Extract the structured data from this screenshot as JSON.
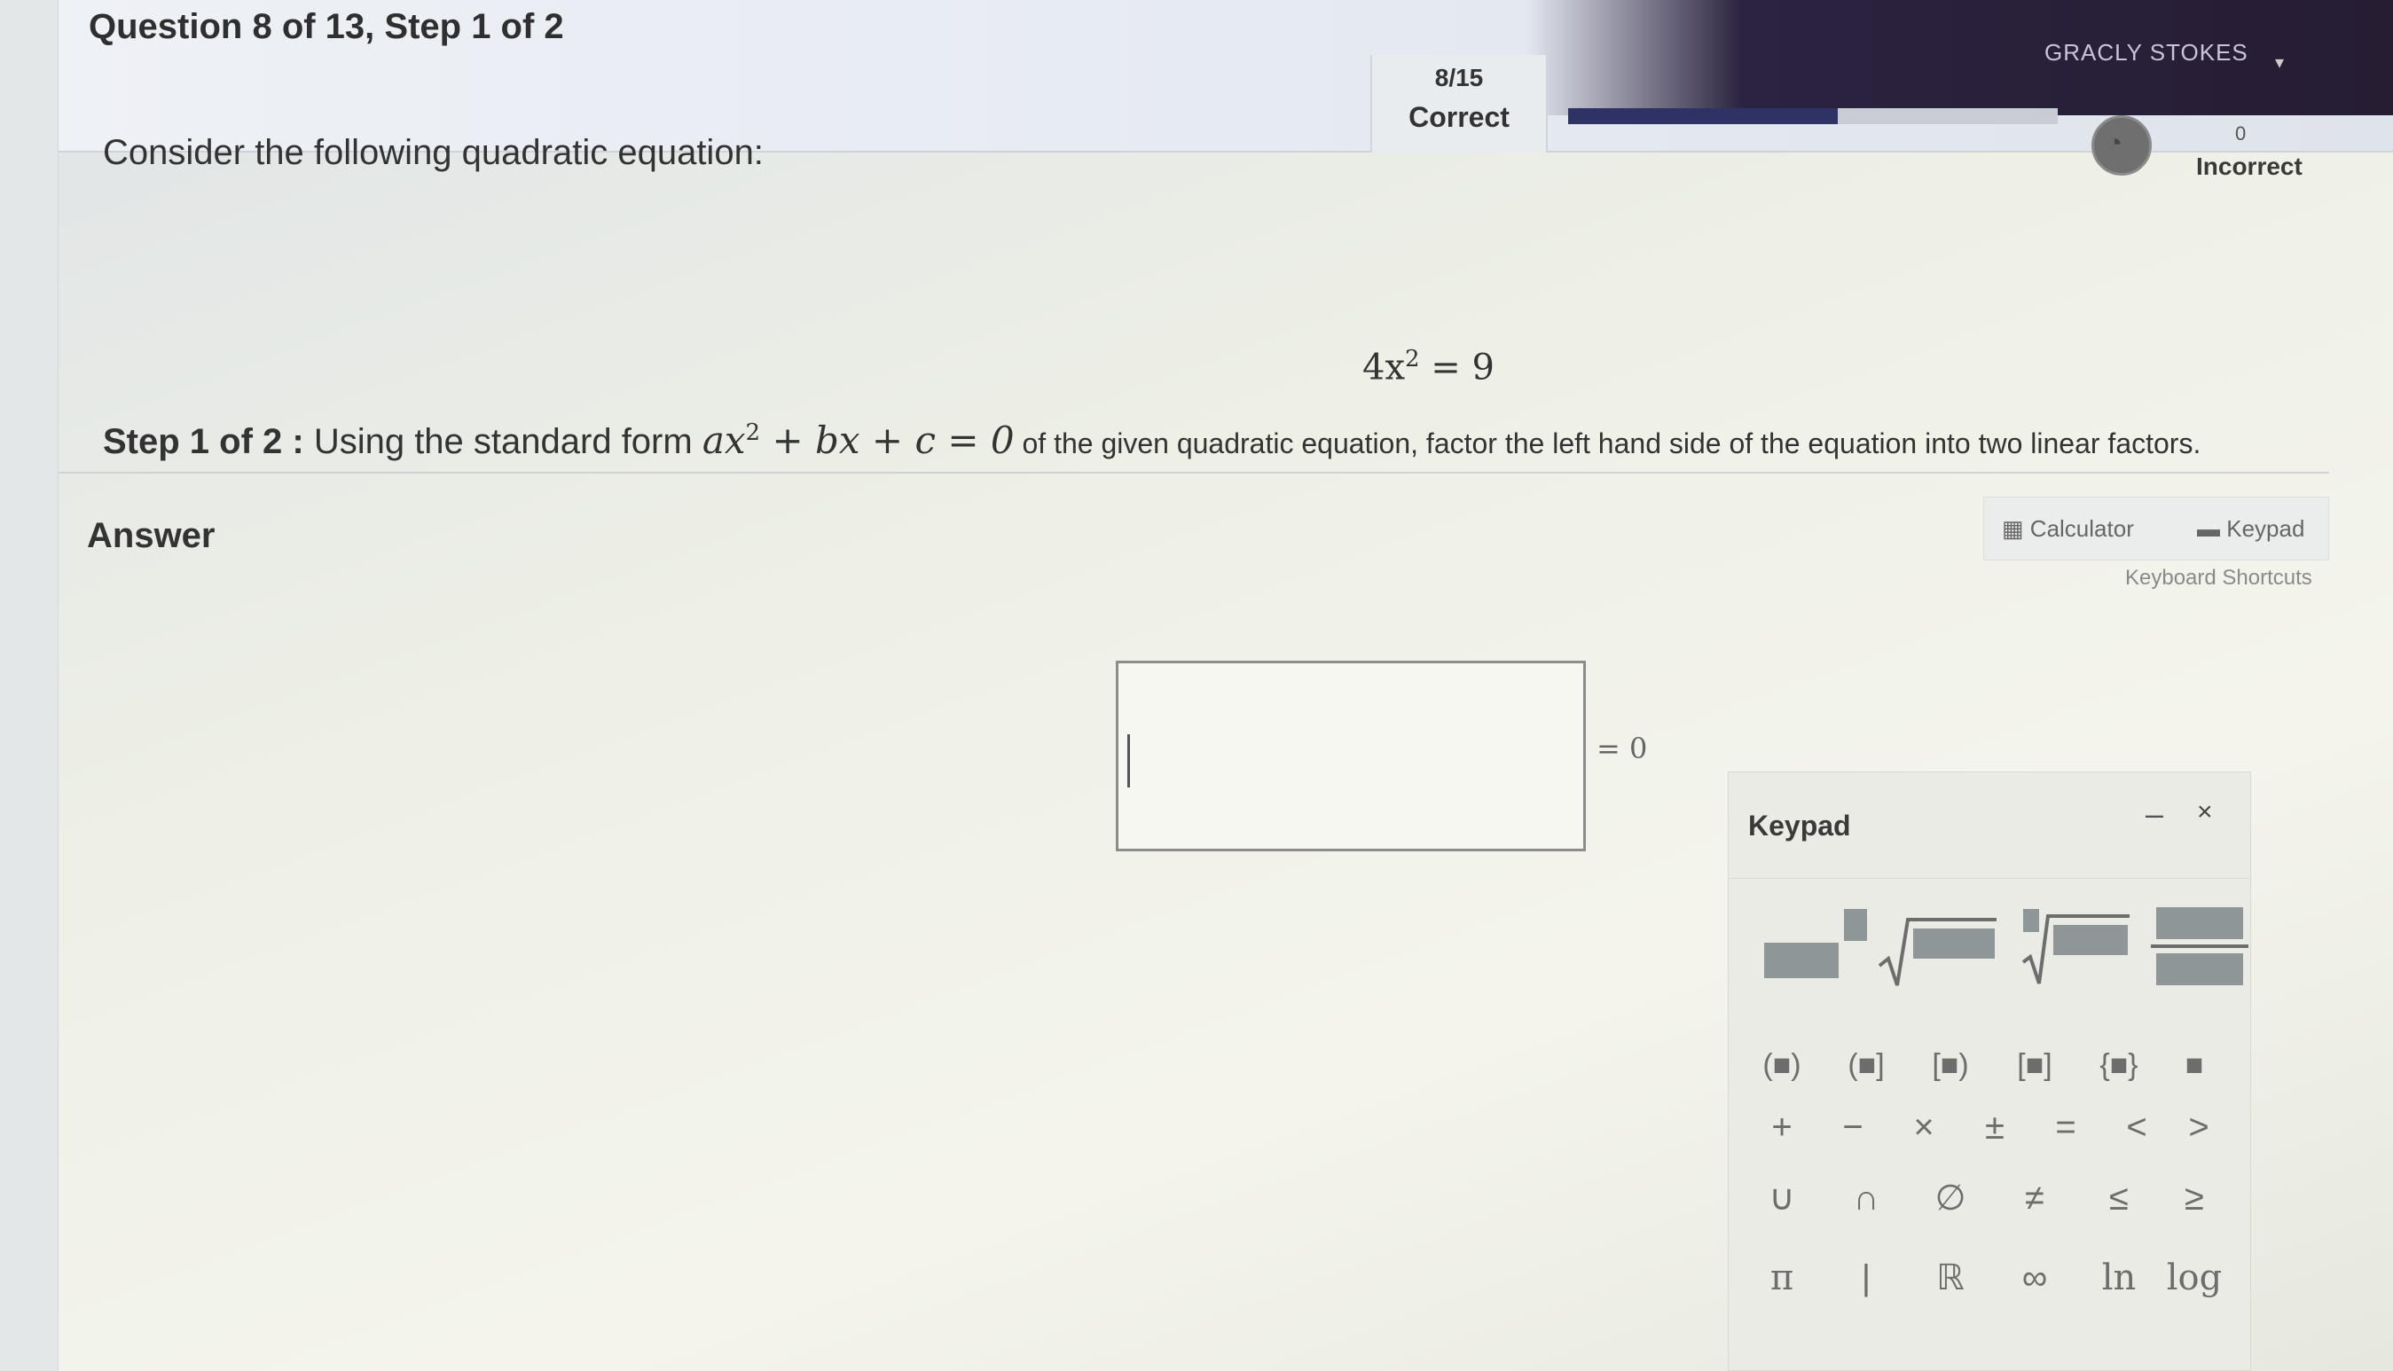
{
  "header": {
    "question_title": "Question 8 of 13,  Step 1 of 2",
    "score": {
      "fraction": "8/15",
      "label": "Correct"
    },
    "progress_fraction": 0.55,
    "incorrect": {
      "count": "0",
      "label": "Incorrect"
    },
    "user_name": "GRACLY STOKES"
  },
  "question": {
    "prompt": "Consider the following quadratic equation:",
    "equation_base": "4x",
    "equation_exp": "2",
    "equation_rest": " = 9",
    "step_label": "Step 1 of 2 :",
    "step_text_before": " Using the standard form ",
    "step_form_a": "ax",
    "step_form_exp": "2",
    "step_form_b": " + bx + c = 0",
    "step_text_after": " of the given quadratic equation, factor the left hand side of the equation into two linear factors."
  },
  "answer": {
    "label": "Answer",
    "suffix": "= 0",
    "tools": {
      "calculator": "Calculator",
      "keypad": "Keypad",
      "shortcuts": "Keyboard Shortcuts"
    }
  },
  "keypad": {
    "title": "Keypad",
    "minimize": "–",
    "close": "×",
    "rows": [
      [
        "(■)",
        "(■]",
        "[■)",
        "[■]",
        "{■}",
        "■"
      ],
      [
        "+",
        "−",
        "×",
        "±",
        "=",
        "<",
        ">"
      ],
      [
        "∪",
        "∩",
        "∅",
        "≠",
        "≤",
        "≥"
      ],
      [
        "π",
        "|",
        "ℝ",
        "∞",
        "ln",
        "log"
      ]
    ]
  },
  "colors": {
    "progress_fill": "#2e3264",
    "header_dark": "#261d33"
  }
}
